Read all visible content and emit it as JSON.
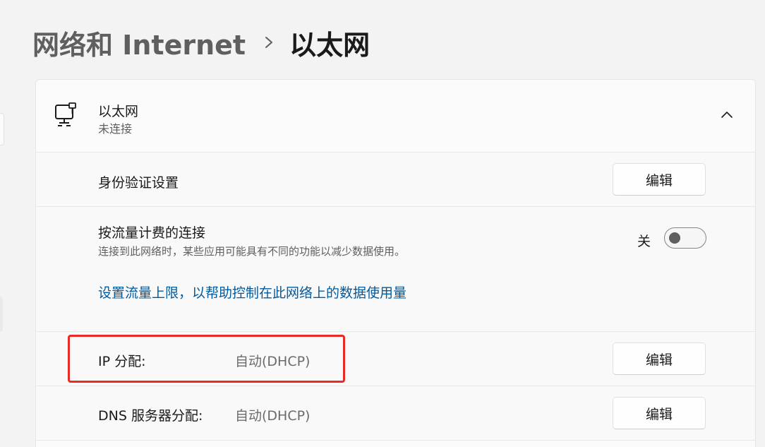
{
  "breadcrumb": {
    "parent": "网络和 Internet",
    "current": "以太网"
  },
  "ethernet_card": {
    "title": "以太网",
    "status": "未连接",
    "icon": "ethernet-icon",
    "expanded": true
  },
  "auth_settings": {
    "label": "身份验证设置",
    "edit_label": "编辑"
  },
  "metered_connection": {
    "label": "按流量计费的连接",
    "description": "连接到此网络时，某些应用可能具有不同的功能以减少数据使用。",
    "toggle_state_label": "关",
    "toggle_on": false,
    "data_limit_link": "设置流量上限，以帮助控制在此网络上的数据使用量"
  },
  "ip_assignment": {
    "label": "IP 分配:",
    "value": "自动(DHCP)",
    "edit_label": "编辑"
  },
  "dns_assignment": {
    "label": "DNS 服务器分配:",
    "value": "自动(DHCP)",
    "edit_label": "编辑"
  },
  "colors": {
    "link": "#005a9e",
    "highlight": "#ea2a24",
    "background": "#f3f3f3"
  }
}
